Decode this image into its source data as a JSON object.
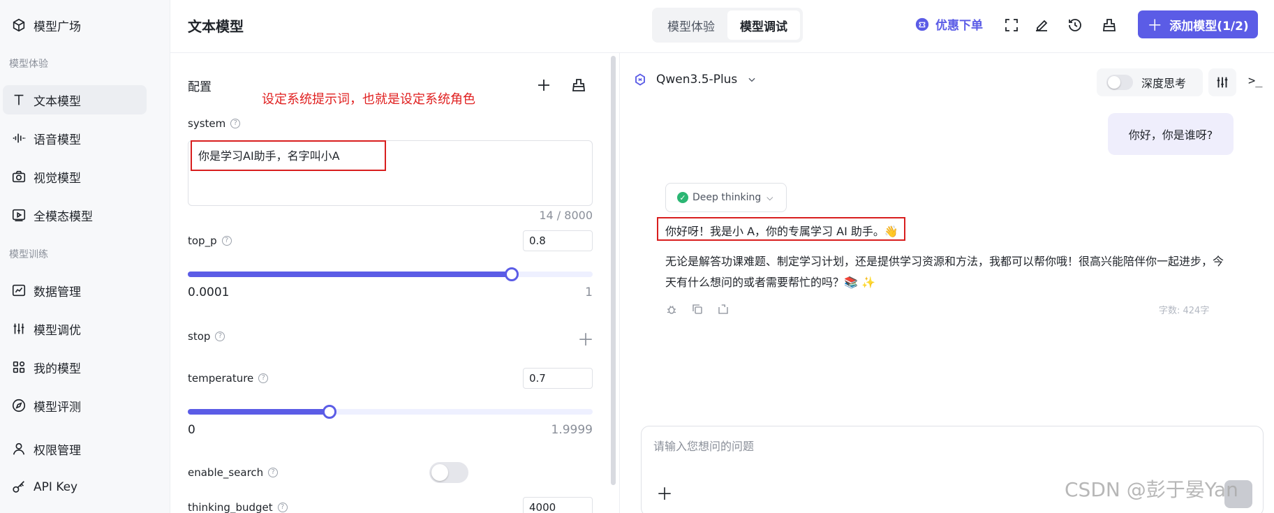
{
  "sidebar": {
    "top_item": "模型广场",
    "sections": [
      {
        "title": "模型体验",
        "items": [
          "文本模型",
          "语音模型",
          "视觉模型",
          "全模态模型"
        ]
      },
      {
        "title": "模型训练",
        "items": [
          "数据管理",
          "模型调优",
          "我的模型",
          "模型评测"
        ]
      }
    ],
    "bottom_items": [
      "权限管理",
      "API Key"
    ],
    "active_item": "文本模型"
  },
  "header": {
    "title": "文本模型",
    "tabs": [
      "模型体验",
      "模型调试"
    ],
    "active_tab": "模型调试",
    "promo_label": "优惠下单",
    "add_button": "添加模型(1/2)",
    "icons": [
      "fullscreen-icon",
      "edit-icon",
      "history-icon",
      "clear-icon"
    ]
  },
  "config": {
    "title": "配置",
    "annotation": "设定系统提示词，也就是设定系统角色",
    "system": {
      "label": "system",
      "value": "你是学习AI助手，名字叫小A",
      "counter": "14 / 8000"
    },
    "top_p": {
      "label": "top_p",
      "value": "0.8",
      "min": "0.0001",
      "max": "1",
      "fraction": 0.8
    },
    "stop": {
      "label": "stop"
    },
    "temperature": {
      "label": "temperature",
      "value": "0.7",
      "min": "0",
      "max": "1.9999",
      "fraction": 0.35
    },
    "enable_search": {
      "label": "enable_search",
      "on": false
    },
    "thinking_budget": {
      "label": "thinking_budget",
      "value": "4000"
    }
  },
  "chat": {
    "model": "Qwen3.5-Plus",
    "deep_think_label": "深度思考",
    "user_message": "你好，你是谁呀?",
    "thinking_chip": "Deep thinking",
    "reply_line1": "你好呀！我是小 A，你的专属学习 AI 助手。👋",
    "reply_line2": "无论是解答功课难题、制定学习计划，还是提供学习资源和方法，我都可以帮你哦！很高兴能陪伴你一起进步，今天有什么想问的或者需要帮忙的吗？📚 ✨",
    "word_count": "字数: 424字",
    "input_placeholder": "请输入您想问的问题",
    "watermark": "CSDN @彭于晏Yan"
  },
  "colors": {
    "accent": "#5b5ce6",
    "annotation_red": "#e02020"
  }
}
